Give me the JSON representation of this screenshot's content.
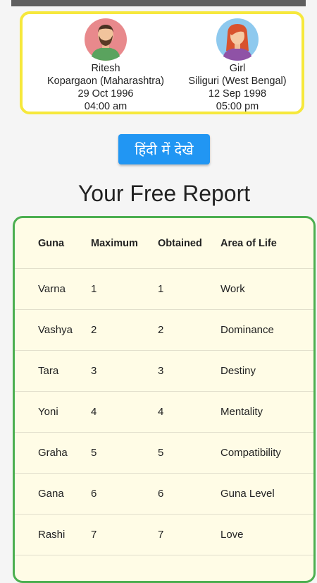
{
  "profiles": {
    "boy": {
      "name": "Ritesh",
      "place": "Kopargaon (Maharashtra)",
      "date": "29 Oct 1996",
      "time": "04:00 am"
    },
    "girl": {
      "name": "Girl",
      "place": "Siliguri (West Bengal)",
      "date": "12 Sep 1998",
      "time": "05:00 pm"
    }
  },
  "hindi_button": {
    "label": "हिंदी में देखे"
  },
  "report": {
    "title": "Your Free Report",
    "columns": [
      "Guna",
      "Maximum",
      "Obtained",
      "Area of Life"
    ],
    "rows": [
      [
        "Varna",
        "1",
        "1",
        "Work"
      ],
      [
        "Vashya",
        "2",
        "2",
        "Dominance"
      ],
      [
        "Tara",
        "3",
        "3",
        "Destiny"
      ],
      [
        "Yoni",
        "4",
        "4",
        "Mentality"
      ],
      [
        "Graha",
        "5",
        "5",
        "Compatibility"
      ],
      [
        "Gana",
        "6",
        "6",
        "Guna Level"
      ],
      [
        "Rashi",
        "7",
        "7",
        "Love"
      ],
      [
        "",
        "",
        "",
        ""
      ]
    ]
  },
  "colors": {
    "profile_border": "#f6e83c",
    "table_border": "#4caf50",
    "table_bg": "#fffce6",
    "button": "#2196f3"
  }
}
